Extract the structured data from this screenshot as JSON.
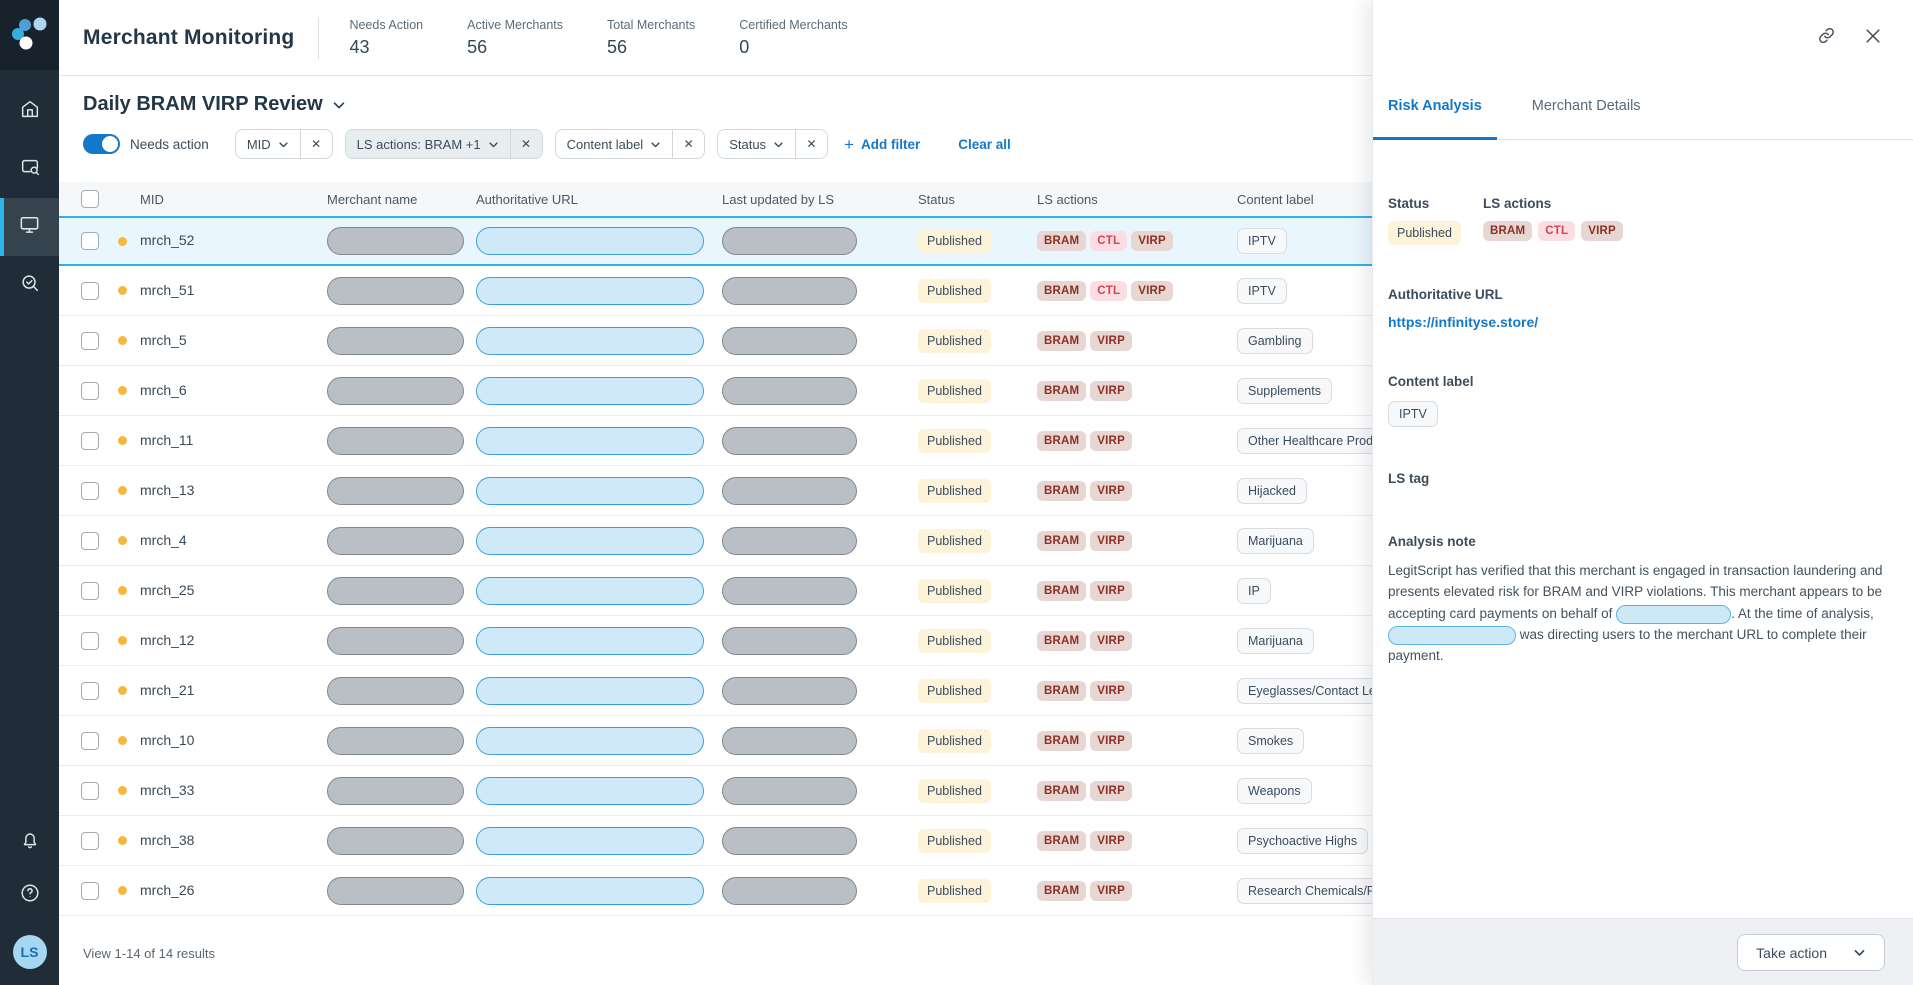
{
  "colors": {
    "accent_blue": "#1478c8",
    "cyan_highlight": "#2db4e7",
    "sidebar_bg": "#202d39",
    "status_badge_bg": "#fcf3d8",
    "action_dark_bg": "#e8d6d2",
    "action_dark_text": "#8c2f24",
    "action_bright_bg": "#fbdee3",
    "action_bright_text": "#d8424d",
    "row_selected_bg": "#e9f6fd",
    "needs_action_dot": "#f6b73c"
  },
  "sidebar": {
    "logo_name": "legitscript-logo",
    "items": [
      {
        "name": "home"
      },
      {
        "name": "merchant-lookup"
      },
      {
        "name": "merchant-monitoring",
        "active": true
      },
      {
        "name": "review"
      }
    ],
    "avatar_initials": "LS"
  },
  "header": {
    "title": "Merchant Monitoring",
    "stats": [
      {
        "label": "Needs Action",
        "value": "43"
      },
      {
        "label": "Active Merchants",
        "value": "56"
      },
      {
        "label": "Total Merchants",
        "value": "56"
      },
      {
        "label": "Certified Merchants",
        "value": "0"
      }
    ]
  },
  "toolbar": {
    "view_title": "Daily BRAM VIRP Review",
    "toggle_label": "Needs action",
    "toggle_on": true,
    "filters": [
      {
        "label": "MID",
        "active": false
      },
      {
        "label": "LS actions: BRAM +1",
        "active": true
      },
      {
        "label": "Content label",
        "active": false
      },
      {
        "label": "Status",
        "active": false
      }
    ],
    "chip_close_glyph": "✕",
    "add_filter_label": "Add filter",
    "clear_all_label": "Clear all"
  },
  "table": {
    "columns": {
      "mid": "MID",
      "merchant_name": "Merchant name",
      "auth_url": "Authoritative URL",
      "last_updated": "Last updated by LS",
      "status": "Status",
      "ls_actions": "LS actions",
      "content_label": "Content label"
    },
    "rows": [
      {
        "mid": "mrch_52",
        "status": "Published",
        "ls_actions": [
          "BRAM",
          "CTL",
          "VIRP"
        ],
        "content_label": "IPTV",
        "selected": true
      },
      {
        "mid": "mrch_51",
        "status": "Published",
        "ls_actions": [
          "BRAM",
          "CTL",
          "VIRP"
        ],
        "content_label": "IPTV",
        "selected": false
      },
      {
        "mid": "mrch_5",
        "status": "Published",
        "ls_actions": [
          "BRAM",
          "VIRP"
        ],
        "content_label": "Gambling",
        "selected": false
      },
      {
        "mid": "mrch_6",
        "status": "Published",
        "ls_actions": [
          "BRAM",
          "VIRP"
        ],
        "content_label": "Supplements",
        "selected": false
      },
      {
        "mid": "mrch_11",
        "status": "Published",
        "ls_actions": [
          "BRAM",
          "VIRP"
        ],
        "content_label": "Other Healthcare Products",
        "selected": false
      },
      {
        "mid": "mrch_13",
        "status": "Published",
        "ls_actions": [
          "BRAM",
          "VIRP"
        ],
        "content_label": "Hijacked",
        "selected": false
      },
      {
        "mid": "mrch_4",
        "status": "Published",
        "ls_actions": [
          "BRAM",
          "VIRP"
        ],
        "content_label": "Marijuana",
        "selected": false
      },
      {
        "mid": "mrch_25",
        "status": "Published",
        "ls_actions": [
          "BRAM",
          "VIRP"
        ],
        "content_label": "IP",
        "selected": false
      },
      {
        "mid": "mrch_12",
        "status": "Published",
        "ls_actions": [
          "BRAM",
          "VIRP"
        ],
        "content_label": "Marijuana",
        "selected": false
      },
      {
        "mid": "mrch_21",
        "status": "Published",
        "ls_actions": [
          "BRAM",
          "VIRP"
        ],
        "content_label": "Eyeglasses/Contact Lenses",
        "selected": false
      },
      {
        "mid": "mrch_10",
        "status": "Published",
        "ls_actions": [
          "BRAM",
          "VIRP"
        ],
        "content_label": "Smokes",
        "selected": false
      },
      {
        "mid": "mrch_33",
        "status": "Published",
        "ls_actions": [
          "BRAM",
          "VIRP"
        ],
        "content_label": "Weapons",
        "selected": false
      },
      {
        "mid": "mrch_38",
        "status": "Published",
        "ls_actions": [
          "BRAM",
          "VIRP"
        ],
        "content_label": "Psychoactive Highs",
        "selected": false
      },
      {
        "mid": "mrch_26",
        "status": "Published",
        "ls_actions": [
          "BRAM",
          "VIRP"
        ],
        "content_label": "Research Chemicals/Peptides",
        "selected": false
      }
    ],
    "results_line": "View 1-14 of 14 results"
  },
  "panel": {
    "tabs": [
      {
        "label": "Risk Analysis",
        "active": true
      },
      {
        "label": "Merchant Details",
        "active": false
      }
    ],
    "status_label": "Status",
    "status_value": "Published",
    "ls_actions_label": "LS actions",
    "ls_actions": [
      "BRAM",
      "CTL",
      "VIRP"
    ],
    "auth_url_label": "Authoritative URL",
    "auth_url": "https://infinityse.store/",
    "content_label_label": "Content label",
    "content_label_value": "IPTV",
    "ls_tag_label": "LS tag",
    "analysis_note_label": "Analysis note",
    "note_part1": "LegitScript has verified that this merchant is engaged in transaction laundering and presents elevated risk for BRAM and VIRP violations. This merchant appears to be accepting card payments on behalf of ",
    "note_part2": ". At the time of analysis, ",
    "note_part3": " was directing users to the merchant URL to complete their payment.",
    "take_action_label": "Take action"
  }
}
